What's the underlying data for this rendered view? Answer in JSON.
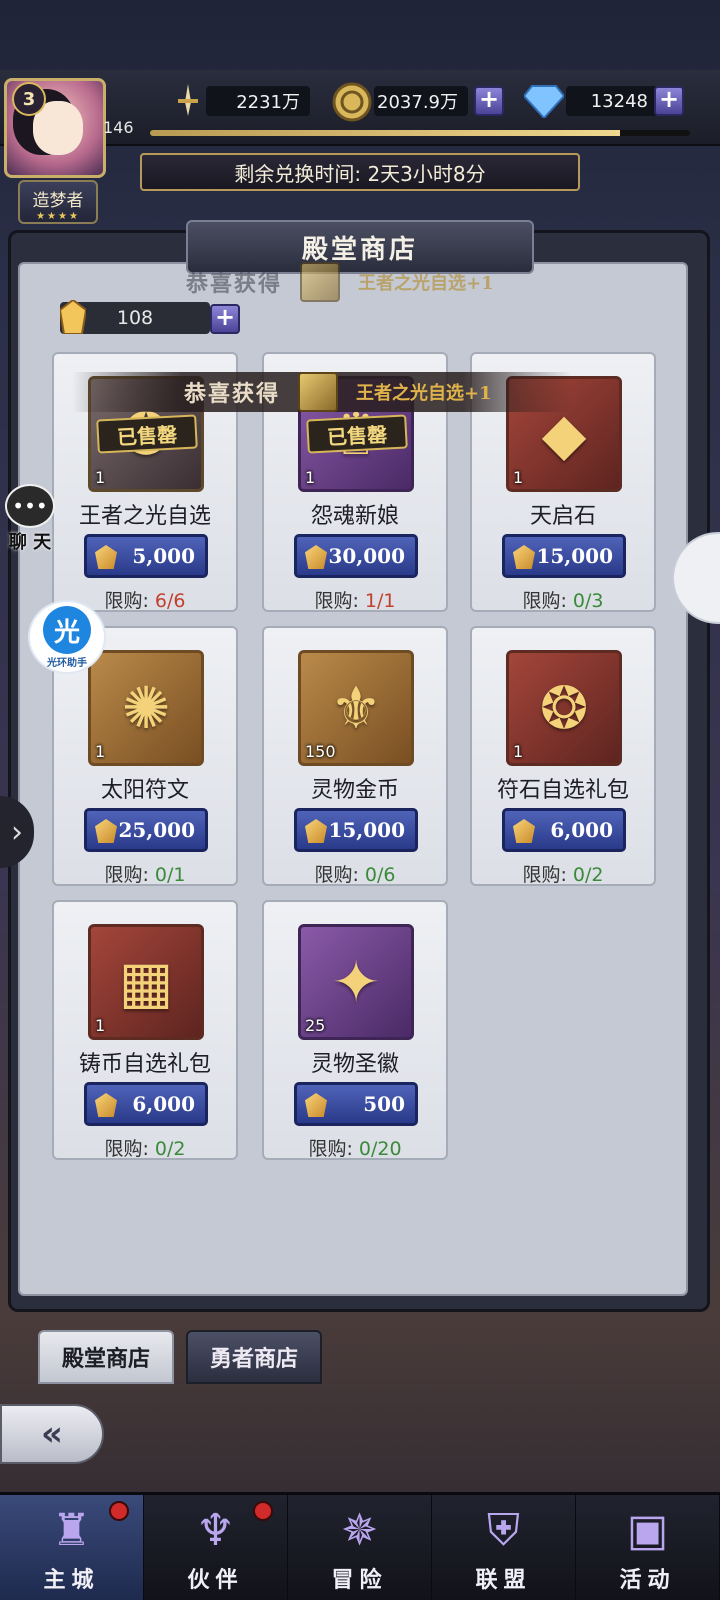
{
  "player": {
    "level": "3",
    "exp": "146",
    "exp_progress": 0.87,
    "title": "造梦者",
    "stars": "★★★★"
  },
  "resources": {
    "power": "2231万",
    "gold": "2037.9万",
    "diamond": "13248",
    "shop_gem": "108"
  },
  "timer": {
    "label": "剩余兑换时间: 2天3小时8分"
  },
  "shop": {
    "title": "殿堂商店",
    "limit_label": "限购:"
  },
  "toasts": [
    {
      "title": "恭喜获得",
      "item": "王者之光自选+1"
    },
    {
      "title": "恭喜获得",
      "item": "王者之光自选+1"
    }
  ],
  "items": [
    {
      "name": "王者之光自选",
      "count": "1",
      "price": "5,000",
      "limit": "6/6",
      "sold": "已售罄",
      "icon": "armor-hero-icon"
    },
    {
      "name": "怨魂新娘",
      "count": "1",
      "price": "30,000",
      "limit": "1/1",
      "sold": "已售罄",
      "icon": "ghost-bride-icon"
    },
    {
      "name": "天启石",
      "count": "1",
      "price": "15,000",
      "limit": "0/3",
      "sold": "",
      "icon": "crystal-stone-icon"
    },
    {
      "name": "太阳符文",
      "count": "1",
      "price": "25,000",
      "limit": "0/1",
      "sold": "",
      "icon": "sun-rune-icon"
    },
    {
      "name": "灵物金币",
      "count": "150",
      "price": "15,000",
      "limit": "0/6",
      "sold": "",
      "icon": "spirit-coin-icon"
    },
    {
      "name": "符石自选礼包",
      "count": "1",
      "price": "6,000",
      "limit": "0/2",
      "sold": "",
      "icon": "rune-bag-icon"
    },
    {
      "name": "铸币自选礼包",
      "count": "1",
      "price": "6,000",
      "limit": "0/2",
      "sold": "",
      "icon": "treasure-chest-icon"
    },
    {
      "name": "灵物圣徽",
      "count": "25",
      "price": "500",
      "limit": "0/20",
      "sold": "",
      "icon": "holy-emblem-icon"
    }
  ],
  "side": {
    "chat_label": "聊 天",
    "helper_glyph": "光",
    "helper_label": "光环助手"
  },
  "tabs": [
    {
      "label": "殿堂商店",
      "active": true
    },
    {
      "label": "勇者商店",
      "active": false
    }
  ],
  "nav": [
    {
      "label": "主城",
      "icon": "castle-icon",
      "active": true,
      "badge": true
    },
    {
      "label": "伙伴",
      "icon": "wizard-hat-icon",
      "active": false,
      "badge": true
    },
    {
      "label": "冒险",
      "icon": "compass-icon",
      "active": false,
      "badge": false
    },
    {
      "label": "联盟",
      "icon": "shield-crest-icon",
      "active": false,
      "badge": false
    },
    {
      "label": "活动",
      "icon": "cards-icon",
      "active": false,
      "badge": false
    }
  ],
  "colors": {
    "limit_full": "#c2402e",
    "limit_ok": "#3b8a3a",
    "price_button": "#3a4ca0",
    "accent_gold": "#d9b85c"
  }
}
